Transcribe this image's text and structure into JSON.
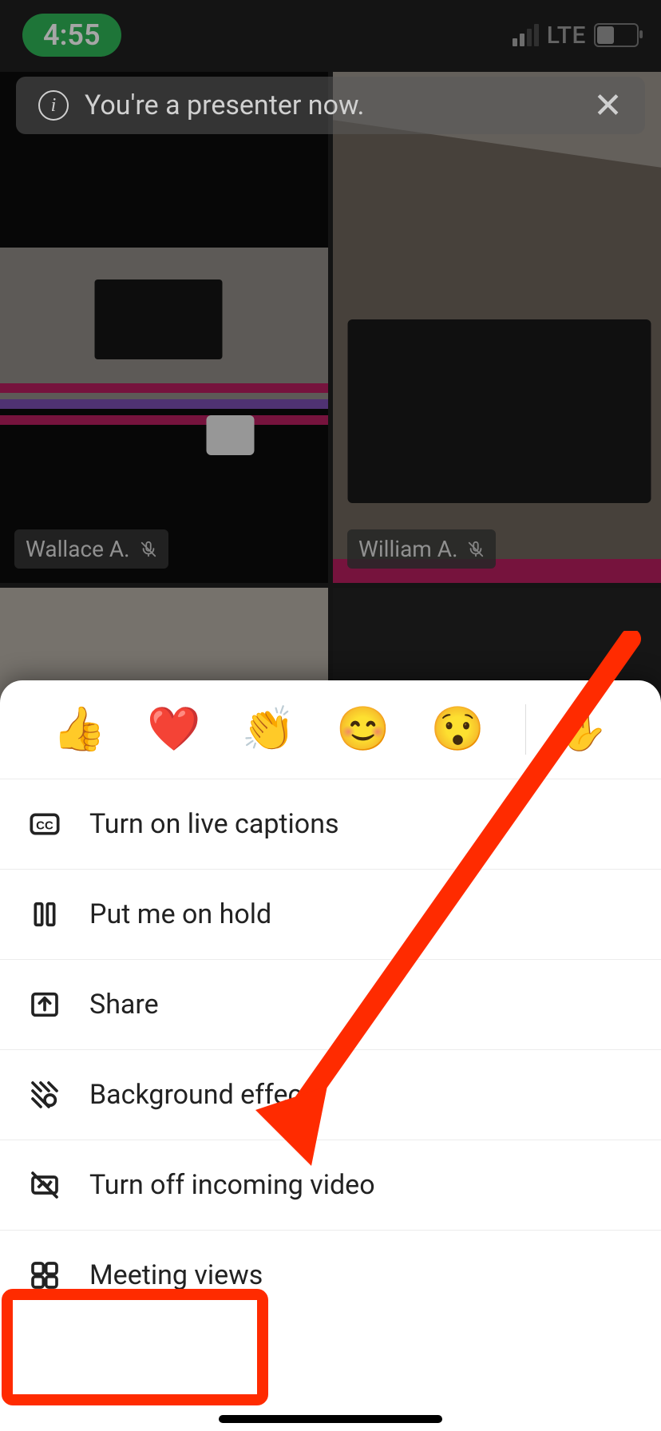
{
  "status": {
    "time": "4:55",
    "network": "LTE"
  },
  "toast": {
    "message": "You're a presenter now."
  },
  "tiles": [
    {
      "name": "Wallace A.",
      "muted": true
    },
    {
      "name": "William A.",
      "muted": true
    }
  ],
  "reactions": {
    "like": "👍",
    "heart": "❤️",
    "applause": "👏",
    "smile": "😊",
    "surprised": "😯",
    "raise_hand": "✋"
  },
  "menu": {
    "live_captions": "Turn on live captions",
    "hold": "Put me on hold",
    "share": "Share",
    "background": "Background effects",
    "turn_off_video": "Turn off incoming video",
    "meeting_views": "Meeting views"
  }
}
